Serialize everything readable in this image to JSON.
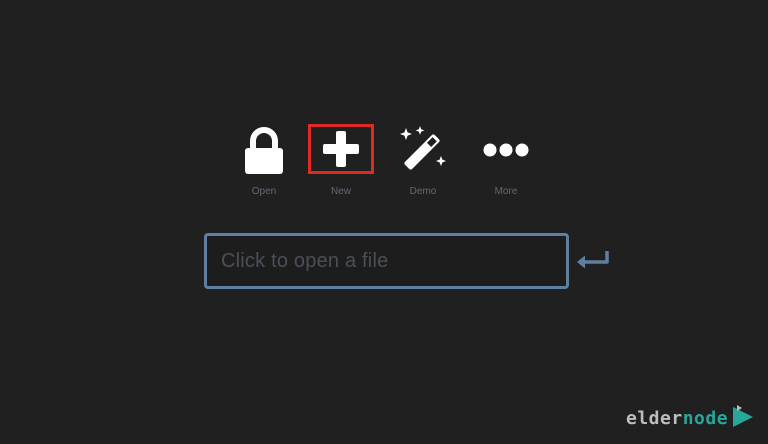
{
  "toolbar": {
    "items": [
      {
        "label": "Open",
        "icon": "lock-icon"
      },
      {
        "label": "New",
        "icon": "plus-icon",
        "highlighted": true
      },
      {
        "label": "Demo",
        "icon": "magic-wand-icon"
      },
      {
        "label": "More",
        "icon": "ellipsis-icon"
      }
    ]
  },
  "file_input": {
    "placeholder": "Click to open a file"
  },
  "watermark": {
    "part1": "elder",
    "part2": "node"
  },
  "colors": {
    "background": "#202020",
    "icon": "#ffffff",
    "label": "#626a75",
    "highlight_border": "#e02a22",
    "input_border": "#5f7f9f",
    "placeholder": "#4a5058",
    "watermark_gray": "#bdbdbd",
    "watermark_teal": "#27a79a"
  }
}
